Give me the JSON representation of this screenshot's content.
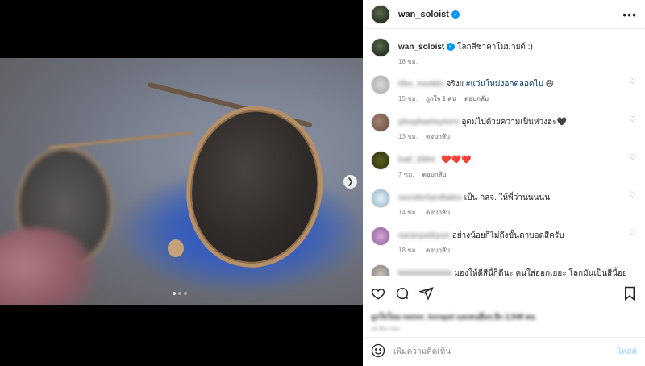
{
  "post": {
    "username": "wan_soloist",
    "verified": true,
    "caption": "โลกสีชาคาโมมายด์ :)",
    "caption_time": "18 ชม."
  },
  "media": {
    "carousel_dots": 3,
    "active_dot": 0
  },
  "comments": [
    {
      "user": "tiko_nookkr",
      "text_pre": "จริง!! ",
      "hashtag": "#แว่นใหม่งอกตลอดไป",
      "emoji": "😄",
      "time": "15 ชม.",
      "likes": "ถูกใจ 1 คน",
      "reply": "ตอบกลับ"
    },
    {
      "user": "phuphaetaytorn",
      "text": "อุดมไปด้วยความเป็นห่วงฮะ🖤",
      "time": "13 ชม.",
      "likes": "",
      "reply": "ตอบกลับ"
    },
    {
      "user": "ball_2004_",
      "text": "❤️❤️❤️",
      "time": "7 ชม.",
      "likes": "",
      "reply": "ตอบกลับ"
    },
    {
      "user": "wonderlandtales",
      "text": "เป็น กลจ. ให้พี่ว่านนนนน",
      "time": "14 ชม.",
      "likes": "",
      "reply": "ตอบกลับ"
    },
    {
      "user": "saranyaikyun",
      "text": "อย่างน้อยก็ไม่ถึงขั้นตาบอดสีครับ",
      "time": "18 ชม.",
      "likes": "",
      "reply": "ตอบกลับ"
    },
    {
      "user": "kkkkkkkkkkkk",
      "text": "มองให้ดีสีนี้ก็ดีนะ คนใส่ออกเยอะ โลกมันเป็นสีนี้อยู่",
      "time": "",
      "likes": "",
      "reply": ""
    }
  ],
  "actions": {
    "likes_text": "ถูกใจโดย nanon_korapat และคนอื่นๆ อีก 2,548 คน",
    "date": "14 ธันวาคม"
  },
  "add_comment": {
    "placeholder": "เพิ่มความคิดเห็น",
    "post_label": "โพสต์"
  },
  "colors": {
    "accent": "#0095f6",
    "heart_red": "#ed4956",
    "muted": "#8e8e8e"
  }
}
